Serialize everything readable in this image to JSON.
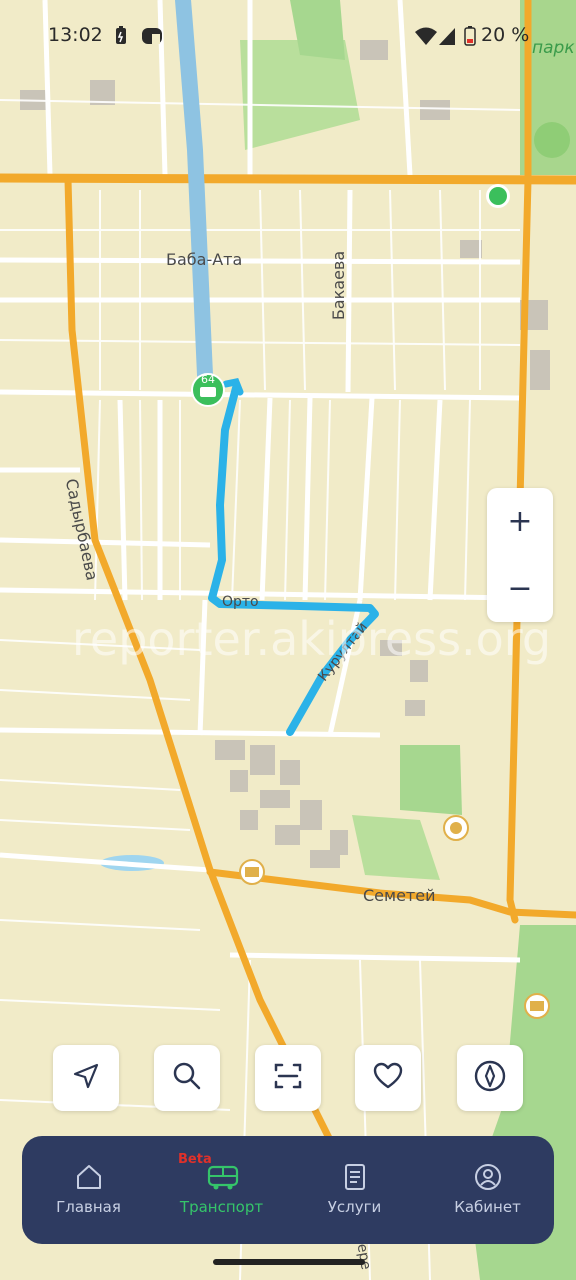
{
  "status_bar": {
    "time": "13:02",
    "battery_text": "20 %",
    "icons": [
      "battery-charging-icon",
      "app-notification-icon",
      "wifi-icon",
      "signal-icon",
      "battery-low-icon"
    ]
  },
  "map": {
    "park_label": "парк Ад",
    "street_labels": {
      "baba_ata": "Баба-Ата",
      "bakaeva": "Бакаева",
      "sadyrbaeva": "Садырбаева",
      "semetei": "Семетей",
      "kurultai": "Курултай",
      "orto": "Орто",
      "bottom": "Бере"
    },
    "bus_stop_route": "64",
    "route_color": "#2bb2e8",
    "previous_route_color": "#8ec3e2",
    "road_color": "#f2a92b",
    "watermark": "reporter.akipress.org"
  },
  "zoom": {
    "in_label": "+",
    "out_label": "−"
  },
  "actions": {
    "icons": [
      "location-arrow-icon",
      "search-icon",
      "scan-icon",
      "heart-icon",
      "compass-icon"
    ]
  },
  "nav": {
    "beta_label": "Beta",
    "items": [
      {
        "label": "Главная",
        "icon": "home-icon"
      },
      {
        "label": "Транспорт",
        "icon": "bus-icon",
        "active": true
      },
      {
        "label": "Услуги",
        "icon": "document-icon"
      },
      {
        "label": "Кабинет",
        "icon": "profile-icon"
      }
    ],
    "active_color": "#35c56a",
    "bg_color": "#2e3b61"
  }
}
